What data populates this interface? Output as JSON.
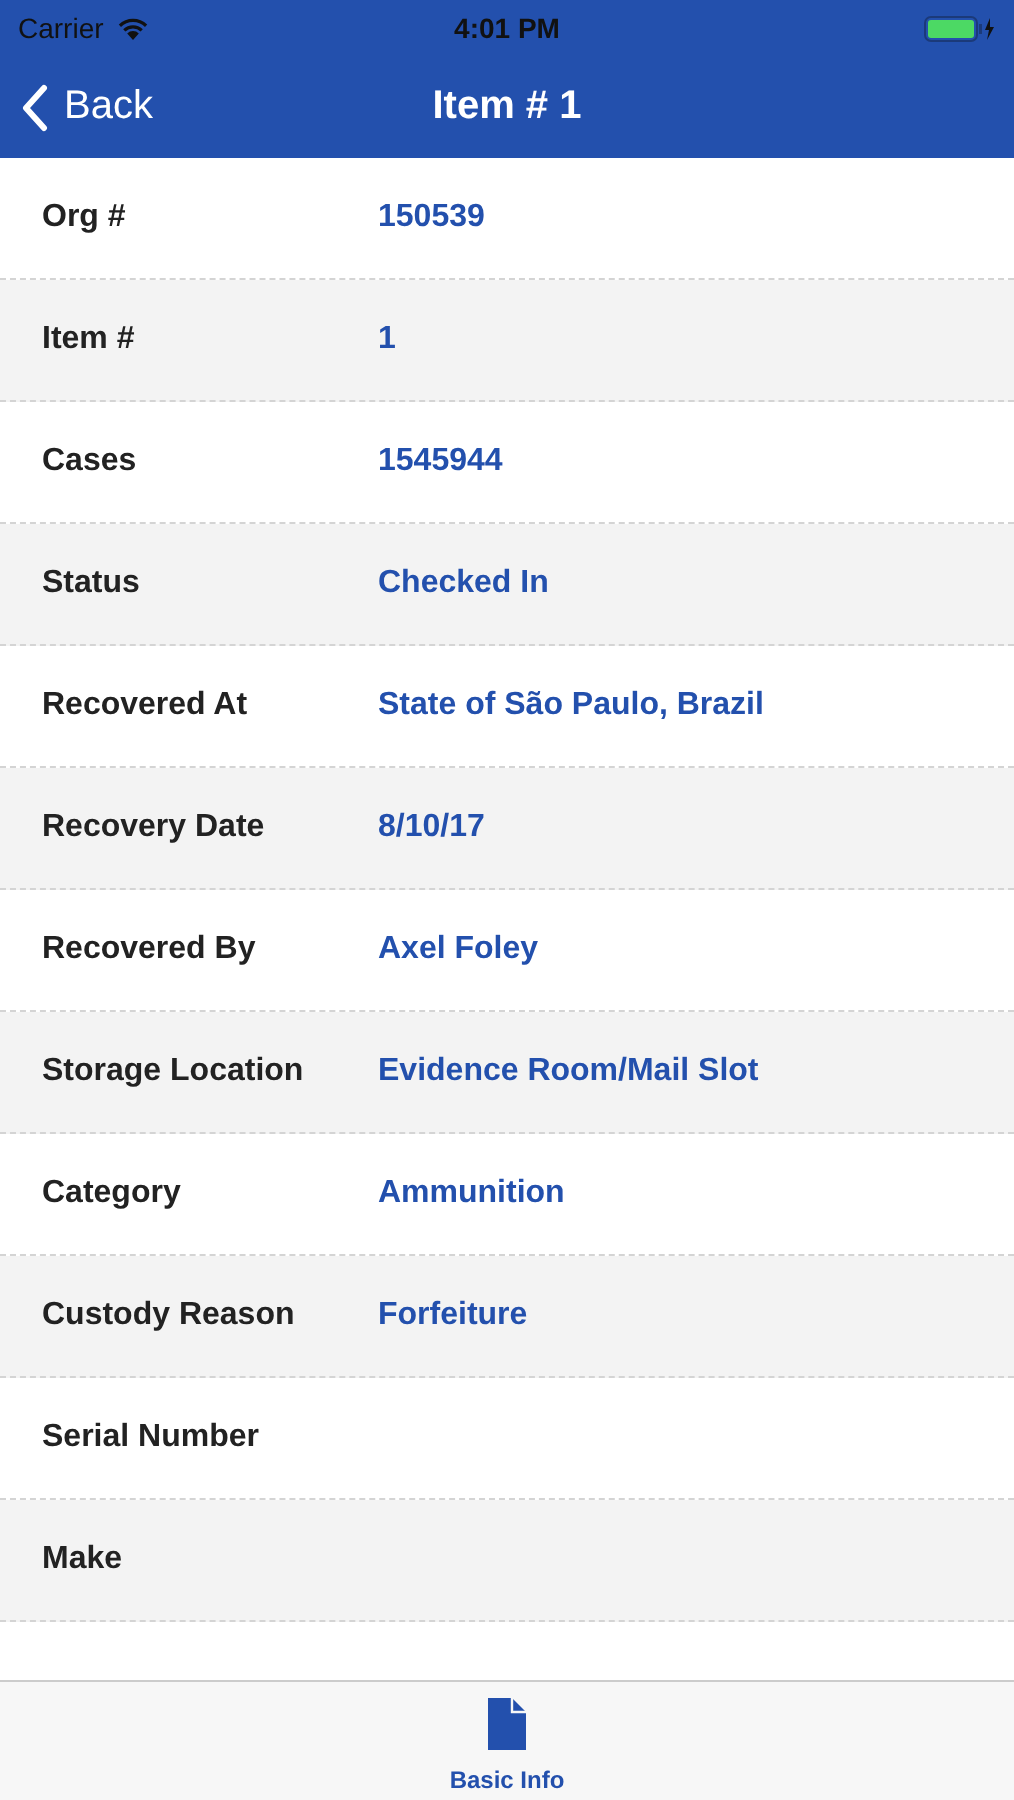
{
  "status_bar": {
    "carrier": "Carrier",
    "time": "4:01 PM"
  },
  "nav": {
    "back": "Back",
    "title": "Item # 1"
  },
  "fields": [
    {
      "label": "Org #",
      "value": "150539"
    },
    {
      "label": "Item #",
      "value": "1"
    },
    {
      "label": "Cases",
      "value": "1545944"
    },
    {
      "label": "Status",
      "value": "Checked In"
    },
    {
      "label": "Recovered At",
      "value": "State of São Paulo, Brazil"
    },
    {
      "label": "Recovery Date",
      "value": "8/10/17"
    },
    {
      "label": "Recovered By",
      "value": "Axel Foley"
    },
    {
      "label": "Storage Location",
      "value": "Evidence Room/Mail Slot"
    },
    {
      "label": "Category",
      "value": "Ammunition"
    },
    {
      "label": "Custody Reason",
      "value": "Forfeiture"
    },
    {
      "label": "Serial Number"
    },
    {
      "label": "Make"
    }
  ],
  "tabs": [
    {
      "label": "Basic Info",
      "selected": true
    }
  ]
}
